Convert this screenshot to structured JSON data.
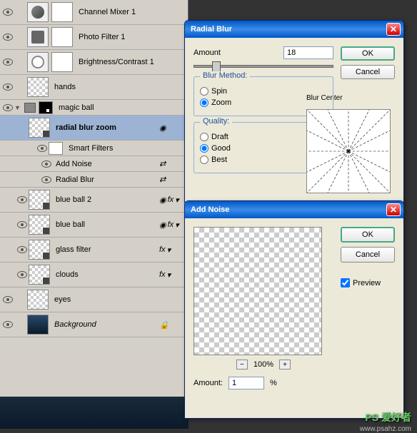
{
  "layers_panel": {
    "items": [
      {
        "name": "Channel Mixer 1",
        "type": "adj-circle"
      },
      {
        "name": "Photo Filter 1",
        "type": "adj-sq"
      },
      {
        "name": "Brightness/Contrast 1",
        "type": "adj-sun"
      },
      {
        "name": "hands",
        "type": "checker"
      },
      {
        "name": "magic ball",
        "type": "group"
      },
      {
        "name": "radial blur zoom",
        "type": "checker",
        "selected": true,
        "bold": true
      },
      {
        "name": "Smart Filters",
        "type": "smart"
      },
      {
        "name": "Add Noise",
        "type": "filter"
      },
      {
        "name": "Radial Blur",
        "type": "filter"
      },
      {
        "name": "blue ball 2",
        "type": "so",
        "fx": true
      },
      {
        "name": "blue ball",
        "type": "so",
        "fx": true
      },
      {
        "name": "glass filter",
        "type": "so",
        "fx": true
      },
      {
        "name": "clouds",
        "type": "so",
        "fx": true
      },
      {
        "name": "eyes",
        "type": "checker"
      },
      {
        "name": "Background",
        "type": "bg",
        "italic": true,
        "locked": true
      }
    ]
  },
  "radial_blur": {
    "title": "Radial Blur",
    "amount_label": "Amount",
    "amount_value": "18",
    "ok": "OK",
    "cancel": "Cancel",
    "method_title": "Blur Method:",
    "spin": "Spin",
    "zoom": "Zoom",
    "quality_title": "Quality:",
    "draft": "Draft",
    "good": "Good",
    "best": "Best",
    "center_label": "Blur Center"
  },
  "add_noise": {
    "title": "Add Noise",
    "ok": "OK",
    "cancel": "Cancel",
    "preview": "Preview",
    "zoom": "100%",
    "amount_label": "Amount:",
    "amount_value": "1",
    "percent": "%"
  },
  "watermark": {
    "text": "PS 爱好者",
    "url": "www.psahz.com"
  }
}
